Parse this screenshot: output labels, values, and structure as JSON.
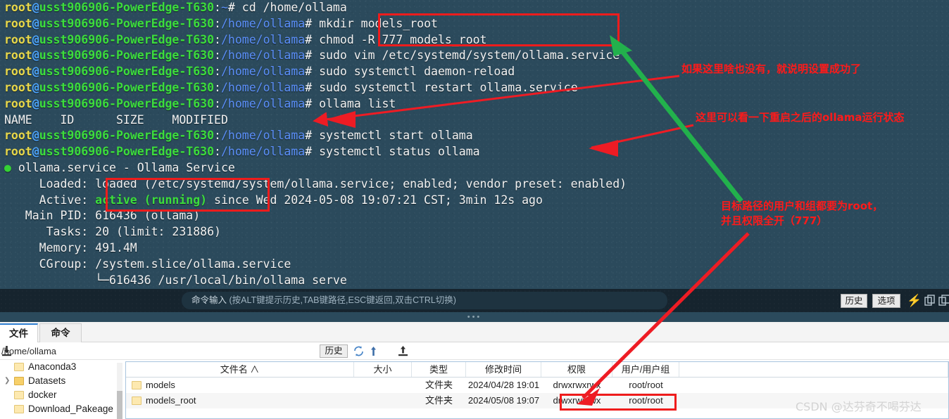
{
  "terminal": {
    "prompt": {
      "user": "root",
      "at": "@",
      "host": "usst906906-PowerEdge-T630",
      "colon": ":",
      "hash": "# "
    },
    "lines": [
      {
        "type": "prompt",
        "path": "~",
        "command": "cd /home/ollama"
      },
      {
        "type": "prompt",
        "path": "/home/ollama",
        "command": "mkdir models_root"
      },
      {
        "type": "prompt",
        "path": "/home/ollama",
        "command": "chmod -R 777 models_root"
      },
      {
        "type": "prompt",
        "path": "/home/ollama",
        "command": "sudo vim /etc/systemd/system/ollama.service"
      },
      {
        "type": "prompt",
        "path": "/home/ollama",
        "command": "sudo systemctl daemon-reload"
      },
      {
        "type": "prompt",
        "path": "/home/ollama",
        "command": "sudo systemctl restart ollama.service"
      },
      {
        "type": "prompt",
        "path": "/home/ollama",
        "command": "ollama list"
      },
      {
        "type": "output",
        "text": "NAME    ID      SIZE    MODIFIED"
      },
      {
        "type": "prompt",
        "path": "/home/ollama",
        "command": "systemctl start ollama"
      },
      {
        "type": "prompt",
        "path": "/home/ollama",
        "command": "systemctl status ollama"
      },
      {
        "type": "status_header",
        "dot": "●",
        "text": " ollama.service - Ollama Service"
      },
      {
        "type": "output",
        "text": "     Loaded: loaded (/etc/systemd/system/ollama.service; enabled; vendor preset: enabled)"
      },
      {
        "type": "active",
        "label": "     Active: ",
        "value": "active (running)",
        "tail": " since Wed 2024-05-08 19:07:21 CST; 3min 12s ago"
      },
      {
        "type": "output",
        "text": "   Main PID: 616436 (ollama)"
      },
      {
        "type": "output",
        "text": "      Tasks: 20 (limit: 231886)"
      },
      {
        "type": "output",
        "text": "     Memory: 491.4M"
      },
      {
        "type": "output",
        "text": "     CGroup: /system.slice/ollama.service"
      },
      {
        "type": "output",
        "text": "             └─616436 /usr/local/bin/ollama serve"
      }
    ]
  },
  "command_bar": {
    "input_label": "命令输入",
    "input_hint": " (按ALT键提示历史,TAB键路径,ESC键返回,双击CTRL切换)",
    "history_button": "历史",
    "options_button": "选项",
    "icons": [
      "bolt-icon",
      "copy-icon",
      "paste-icon"
    ]
  },
  "file_manager": {
    "tabs": [
      {
        "label": "文件",
        "active": true
      },
      {
        "label": "命令",
        "active": false
      }
    ],
    "path": "/home/ollama",
    "history_button": "历史",
    "toolbar_icons": [
      "refresh-icon",
      "up-icon",
      "download-icon",
      "upload-icon"
    ],
    "tree": [
      {
        "label": "Anaconda3",
        "expandable": false,
        "open": false
      },
      {
        "label": "Datasets",
        "expandable": true,
        "open": true
      },
      {
        "label": "docker",
        "expandable": false,
        "open": false
      },
      {
        "label": "Download_Pakeage",
        "expandable": false,
        "open": false
      }
    ],
    "columns": [
      {
        "label": "文件名",
        "sort": "∧"
      },
      {
        "label": "大小",
        "sort": ""
      },
      {
        "label": "类型",
        "sort": ""
      },
      {
        "label": "修改时间",
        "sort": ""
      },
      {
        "label": "权限",
        "sort": ""
      },
      {
        "label": "用户/用户组",
        "sort": ""
      }
    ],
    "rows": [
      {
        "name": "models",
        "size": "",
        "type": "文件夹",
        "mtime": "2024/04/28 19:01",
        "perm": "drwxrwxrwx",
        "owner": "root/root"
      },
      {
        "name": "models_root",
        "size": "",
        "type": "文件夹",
        "mtime": "2024/05/08 19:07",
        "perm": "drwxrwxrwx",
        "owner": "root/root"
      }
    ]
  },
  "annotations": [
    {
      "id": "anno-success",
      "text": "如果这里啥也没有，就说明设置成功了"
    },
    {
      "id": "anno-status",
      "text": "这里可以看一下重启之后的ollama运行状态"
    },
    {
      "id": "anno-perm-line1",
      "text": "目标路径的用户和组都要为root，"
    },
    {
      "id": "anno-perm-line2",
      "text": "并且权限全开（777）"
    }
  ],
  "watermark": "CSDN @达芬奇不喝芬达",
  "colors": {
    "terminal_bg": "#2b4a5c",
    "prompt_user": "#e8d84a",
    "prompt_host": "#3cdd3c",
    "prompt_path": "#5b8ff9",
    "annotation_red": "#ff1a1a",
    "arrow_green": "#22b14c",
    "arrow_red": "#ee1c24",
    "tab_accent": "#2f7fd1"
  }
}
